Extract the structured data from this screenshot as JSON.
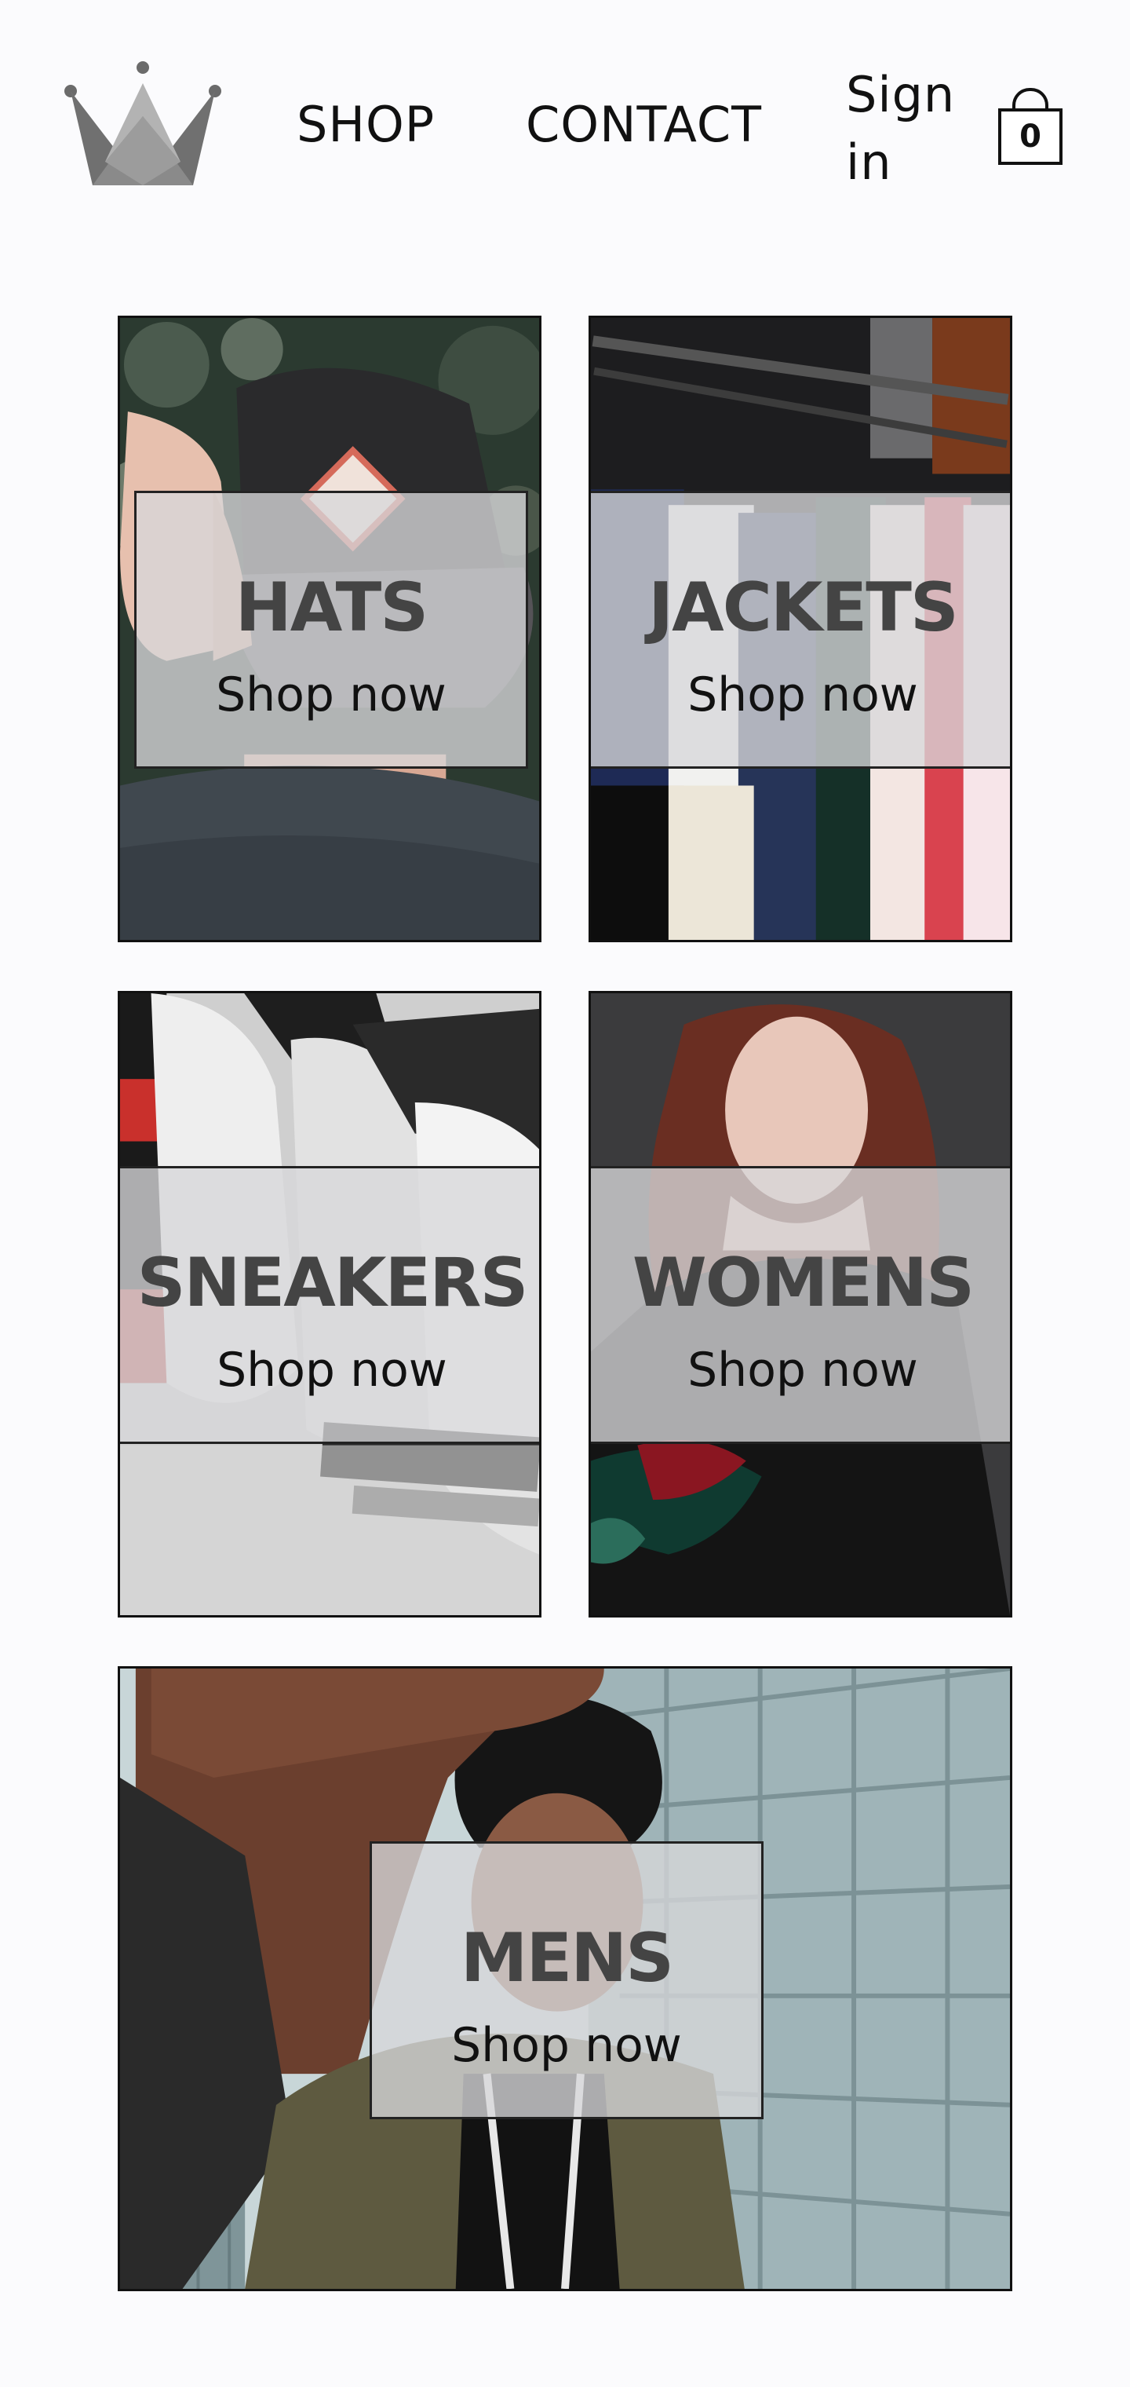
{
  "header": {
    "logo_icon": "crown-icon",
    "nav": {
      "shop": "SHOP",
      "contact": "CONTACT",
      "signin": "Sign in"
    },
    "cart": {
      "icon": "shopping-bag-icon",
      "count": "0"
    }
  },
  "categories": [
    {
      "title": "HATS",
      "cta": "Shop now"
    },
    {
      "title": "JACKETS",
      "cta": "Shop now"
    },
    {
      "title": "SNEAKERS",
      "cta": "Shop now"
    },
    {
      "title": "WOMENS",
      "cta": "Shop now"
    },
    {
      "title": "MENS",
      "cta": "Shop now"
    }
  ],
  "colors": {
    "background": "#fbfbfd",
    "text": "#111111",
    "overlay": "#d7d7da",
    "title": "#444444"
  }
}
